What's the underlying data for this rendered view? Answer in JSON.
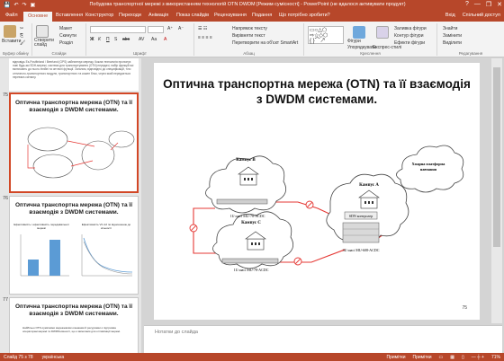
{
  "window": {
    "title": "Побудова транспортної мережі з використанням технологій OTN DWDM [Режим сумісності] - PowerPoint (не вдалося активувати продукт)",
    "controls": [
      "?",
      "—",
      "❐",
      "✕"
    ]
  },
  "tabs": [
    "Файл",
    "Основне",
    "Вставлення",
    "Конструктор",
    "Переходи",
    "Анімація",
    "Показ слайдів",
    "Рецензування",
    "Подання",
    "Що потрібно зробити?"
  ],
  "tabs_right": [
    "Вхід",
    "Спільний доступ"
  ],
  "ribbon": {
    "groups": [
      "Буфер обміну",
      "Слайди",
      "Шрифт",
      "Абзац",
      "Креслення",
      "Редагування"
    ],
    "clipboard": {
      "paste": "Вставити"
    },
    "slides": {
      "new_slide": "Створити слайд",
      "layout": "Макет",
      "reset": "Скинути",
      "section": "Розділ"
    },
    "paragraph": {
      "direction": "Напрямок тексту",
      "align": "Вирівняти текст",
      "smartart": "Перетворити на об'єкт SmartArt"
    },
    "drawing": {
      "shapes": "Фігури",
      "arrange": "Упорядкувати",
      "quick_styles": "Експрес-стилі",
      "fill": "Заливка фігури",
      "outline": "Контур фігури",
      "effects": "Ефекти фігури"
    },
    "editing": {
      "find": "Знайти",
      "replace": "Замінити",
      "select": "Виділити"
    }
  },
  "thumbnails": {
    "doc_text": "відповідь Es-Postfinland / Beerland (GPS) забезпечує мережу. Кожна технологія пропонує нові будь-які SDH-мережі, системи для транспортування (OTN) передачі, набір функцій які включають до нього лінійні та оптичні функції. Загалом, відповідно до специфікацій, тіло оптичного-транспортного модуля, транспортного та кожен блок, через який передається перевага сигналу.",
    "slides": [
      {
        "num": "75",
        "title": "Оптична транспортна мережа (OTN) та її взаємодія з DWDM системами."
      },
      {
        "num": "76",
        "title": "Оптична транспортна мережа (OTN) та її взаємодія з DWDM системами."
      },
      {
        "num": "77",
        "title": "Оптична транспортна мережа (OTN) та її взаємодія з DWDM системами."
      }
    ],
    "slide76_chart_left": "Ефективність і ефективність передавальної мережі",
    "slide76_chart_right": "Ефективність VC-12 по відношенню до кількості",
    "slide77_body": "Найбільш OTN-сумісними мережевими ознаками й ресурсами є підтримка операторам мережі та DWDM-ємності, що є вимогами для оптимізації мережі."
  },
  "slide": {
    "title": "Оптична транспортна мережа (OTN) та її взаємодія з DWDM системами.",
    "page_number": "75",
    "diagram": {
      "campus_b": "Кампус В",
      "campus_c": "Кампус С",
      "campus_a": "Кампус А",
      "cloud": "Хмарна платформа навчання",
      "node_b": "1U шасі MU-78-ACDC",
      "node_c": "1U шасі MU-78-ACDC",
      "node_a": "3U шасі MU-608-ACDC",
      "controller": "SDN контролер"
    }
  },
  "notes_placeholder": "Нотатки до слайда",
  "status": {
    "slide": "Слайд 75 з 78",
    "language": "українська",
    "notes": "Примітки",
    "comments": "Примітки",
    "zoom": "71%"
  },
  "colors": {
    "accent": "#b7472a",
    "selection": "#d24726",
    "link": "#e53935"
  }
}
